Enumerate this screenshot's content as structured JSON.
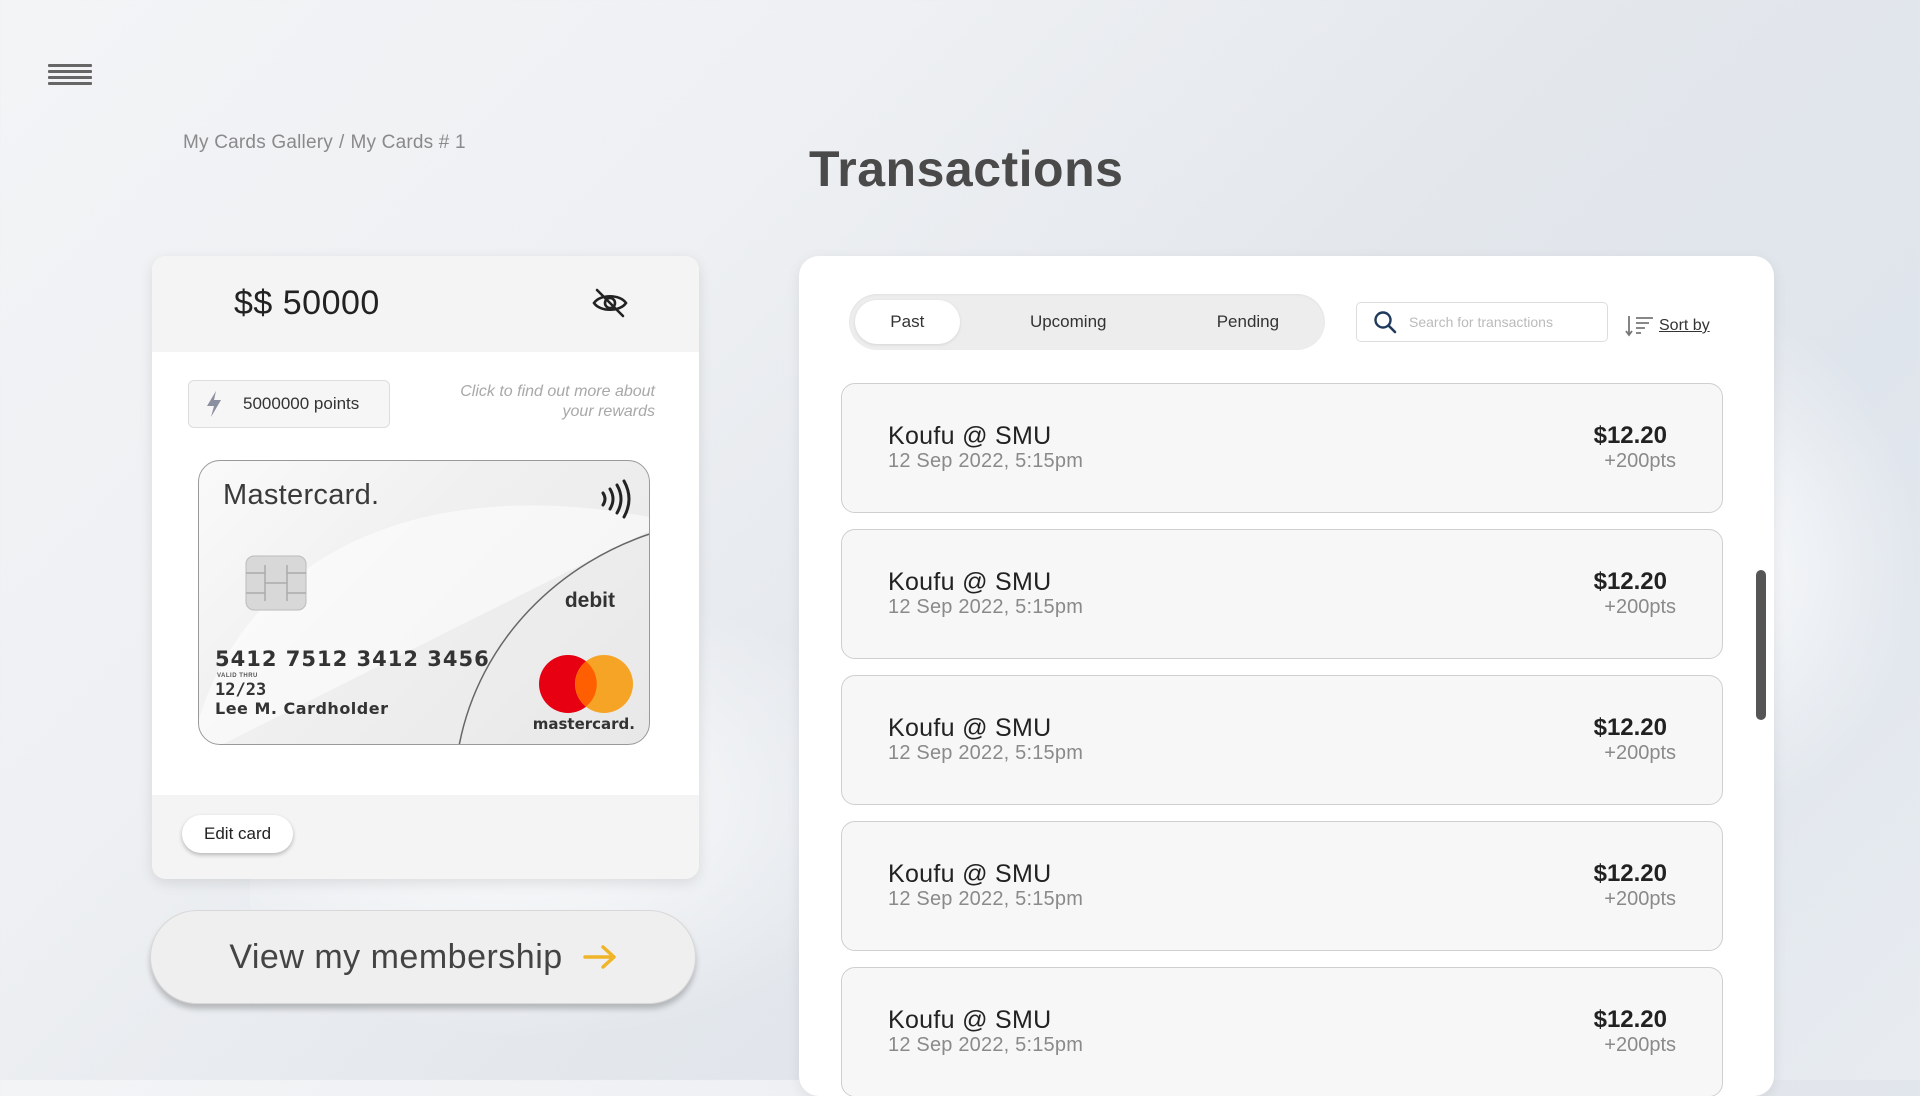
{
  "breadcrumb": {
    "gallery": "My Cards Gallery",
    "separator": "/",
    "current": "My Cards # 1"
  },
  "page_title": "Transactions",
  "card_panel": {
    "balance": "$$ 50000",
    "visibility_icon": "eye-off-icon",
    "points": "5000000 points",
    "points_icon": "lightning-bolt-icon",
    "rewards_hint": "Click to find out more about your rewards",
    "card": {
      "brand": "Mastercard.",
      "type": "debit",
      "number": "5412 7512 3412 3456",
      "valid_thru_label": "VALID THRU",
      "expiry": "12/23",
      "cardholder": "Lee M. Cardholder",
      "wordmark": "mastercard."
    },
    "edit_button": "Edit card"
  },
  "membership_button": "View my membership",
  "accent_color": "#f0b429",
  "transactions": {
    "tabs": [
      "Past",
      "Upcoming",
      "Pending"
    ],
    "active_tab": "Past",
    "search_placeholder": "Search for transactions",
    "sort_label": "Sort by",
    "items": [
      {
        "merchant": "Koufu @ SMU",
        "date": "12 Sep 2022, 5:15pm",
        "amount": "$12.20",
        "points": "+200pts"
      },
      {
        "merchant": "Koufu @ SMU",
        "date": "12 Sep 2022, 5:15pm",
        "amount": "$12.20",
        "points": "+200pts"
      },
      {
        "merchant": "Koufu @ SMU",
        "date": "12 Sep 2022, 5:15pm",
        "amount": "$12.20",
        "points": "+200pts"
      },
      {
        "merchant": "Koufu @ SMU",
        "date": "12 Sep 2022, 5:15pm",
        "amount": "$12.20",
        "points": "+200pts"
      },
      {
        "merchant": "Koufu @ SMU",
        "date": "12 Sep 2022, 5:15pm",
        "amount": "$12.20",
        "points": "+200pts"
      }
    ]
  }
}
